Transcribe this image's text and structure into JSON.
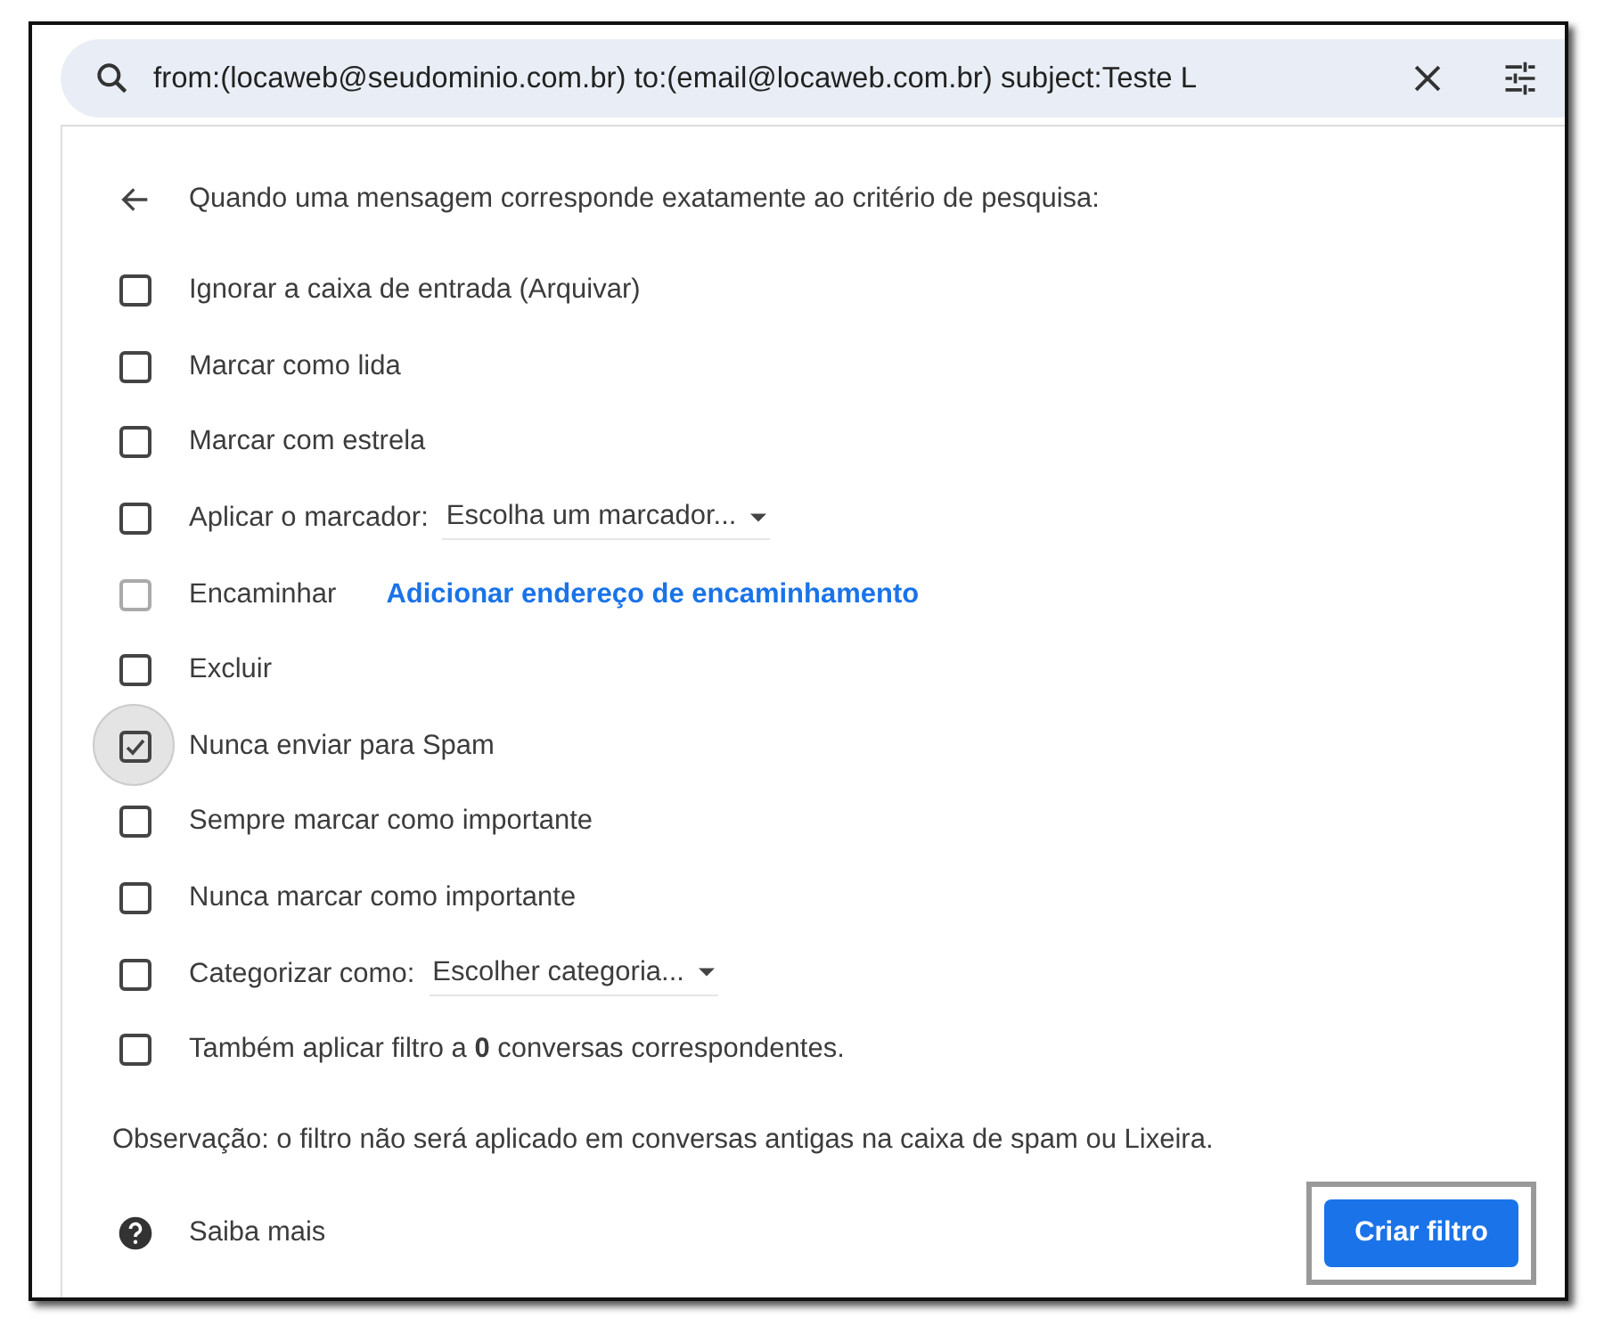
{
  "search": {
    "value": "from:(locaweb@seudominio.com.br) to:(email@locaweb.com.br) subject:Teste L"
  },
  "header": "Quando uma mensagem corresponde exatamente ao critério de pesquisa:",
  "options": [
    {
      "kind": "plain",
      "label": "Ignorar a caixa de entrada (Arquivar)",
      "checked": false,
      "disabled": false
    },
    {
      "kind": "plain",
      "label": "Marcar como lida",
      "checked": false,
      "disabled": false
    },
    {
      "kind": "plain",
      "label": "Marcar com estrela",
      "checked": false,
      "disabled": false
    },
    {
      "kind": "select",
      "label": "Aplicar o marcador:",
      "select": "Escolha um marcador...",
      "checked": false,
      "disabled": false
    },
    {
      "kind": "link",
      "label": "Encaminhar",
      "link": "Adicionar endereço de encaminhamento",
      "checked": false,
      "disabled": true
    },
    {
      "kind": "plain",
      "label": "Excluir",
      "checked": false,
      "disabled": false
    },
    {
      "kind": "plain",
      "label": "Nunca enviar para Spam",
      "checked": true,
      "disabled": false
    },
    {
      "kind": "plain",
      "label": "Sempre marcar como importante",
      "checked": false,
      "disabled": false
    },
    {
      "kind": "plain",
      "label": "Nunca marcar como importante",
      "checked": false,
      "disabled": false
    },
    {
      "kind": "select",
      "label": "Categorizar como:",
      "select": "Escolher categoria...",
      "checked": false,
      "disabled": false
    },
    {
      "kind": "plain",
      "label": "Também aplicar filtro a **0** conversas correspondentes.",
      "checked": false,
      "disabled": false
    }
  ],
  "note": "Observação: o filtro não será aplicado em conversas antigas na caixa de spam ou Lixeira.",
  "learn_more": "Saiba mais",
  "create_button": "Criar filtro"
}
